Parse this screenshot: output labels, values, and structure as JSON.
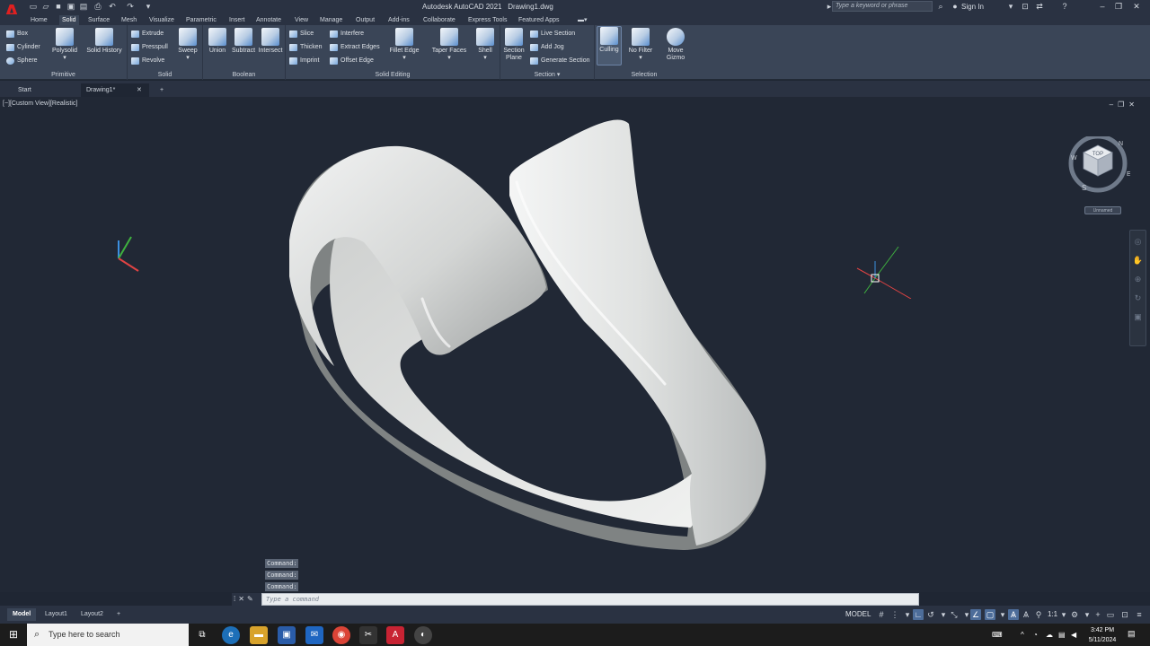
{
  "app": {
    "title": "Autodesk AutoCAD 2021",
    "file": "Drawing1.dwg",
    "logo": "A"
  },
  "header": {
    "search_placeholder": "Type a keyword or phrase",
    "sign_in": "Sign In"
  },
  "ribbon_tabs": [
    "Home",
    "Solid",
    "Surface",
    "Mesh",
    "Visualize",
    "Parametric",
    "Insert",
    "Annotate",
    "View",
    "Manage",
    "Output",
    "Add-ins",
    "Collaborate",
    "Express Tools",
    "Featured Apps"
  ],
  "panels": {
    "primitive": {
      "title": "Primitive",
      "box": "Box",
      "cylinder": "Cylinder",
      "sphere": "Sphere",
      "polysolid": "Polysolid"
    },
    "solid": {
      "title": "Solid",
      "history": "Solid History",
      "extrude": "Extrude",
      "presspull": "Presspull",
      "revolve": "Revolve",
      "sweep": "Sweep"
    },
    "boolean": {
      "title": "Boolean",
      "union": "Union",
      "subtract": "Subtract",
      "intersect": "Intersect"
    },
    "editing": {
      "title": "Solid Editing",
      "slice": "Slice",
      "thicken": "Thicken",
      "imprint": "Imprint",
      "interfere": "Interfere",
      "extract": "Extract Edges",
      "offset": "Offset Edge",
      "fillet": "Fillet Edge",
      "taper": "Taper Faces",
      "shell": "Shell"
    },
    "section": {
      "title": "Section",
      "plane": "Section Plane",
      "live": "Live Section",
      "jog": "Add Jog",
      "generate": "Generate Section"
    },
    "selection": {
      "title": "Selection",
      "culling": "Culling",
      "nofilter": "No Filter",
      "gizmo": "Move Gizmo"
    }
  },
  "doc_tabs": {
    "start": "Start",
    "drawing": "Drawing1*"
  },
  "viewport": {
    "label": "[−][Custom View][Realistic]",
    "cube_face": "TOP",
    "compass": {
      "n": "N",
      "s": "S",
      "e": "E",
      "w": "W"
    },
    "view_name": "Unnamed"
  },
  "command": {
    "history": [
      "Command:",
      "Command:",
      "Command:"
    ],
    "placeholder": "Type a command"
  },
  "layout_tabs": [
    "Model",
    "Layout1",
    "Layout2"
  ],
  "status": {
    "model": "MODEL",
    "scale": "1:1"
  },
  "taskbar": {
    "search": "Type here to search",
    "time": "3:42 PM",
    "date": "5/11/2024"
  }
}
